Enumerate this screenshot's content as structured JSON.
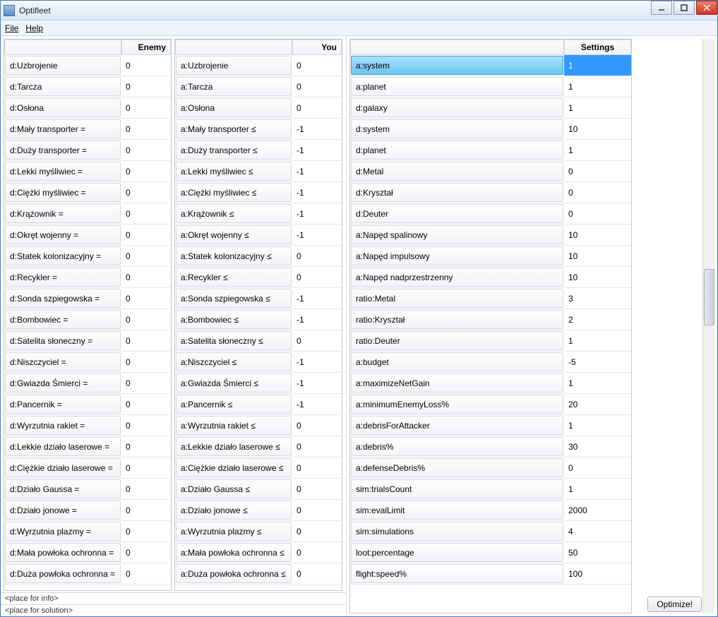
{
  "window": {
    "title": "Optifleet"
  },
  "menu": {
    "file": "File",
    "help": "Help"
  },
  "headers": {
    "enemy": "Enemy",
    "you": "You",
    "settings": "Settings"
  },
  "enemy_rows": [
    {
      "k": "d:Uzbrojenie",
      "v": "0"
    },
    {
      "k": "d:Tarcza",
      "v": "0"
    },
    {
      "k": "d:Osłona",
      "v": "0"
    },
    {
      "k": "d:Mały transporter =",
      "v": "0"
    },
    {
      "k": "d:Duży transporter =",
      "v": "0"
    },
    {
      "k": "d:Lekki myśliwiec =",
      "v": "0"
    },
    {
      "k": "d:Ciężki myśliwiec =",
      "v": "0"
    },
    {
      "k": "d:Krążownik =",
      "v": "0"
    },
    {
      "k": "d:Okręt wojenny =",
      "v": "0"
    },
    {
      "k": "d:Statek kolonizacyjny =",
      "v": "0"
    },
    {
      "k": "d:Recykler =",
      "v": "0"
    },
    {
      "k": "d:Sonda szpiegowska =",
      "v": "0"
    },
    {
      "k": "d:Bombowiec =",
      "v": "0"
    },
    {
      "k": "d:Satelita słoneczny =",
      "v": "0"
    },
    {
      "k": "d:Niszczyciel =",
      "v": "0"
    },
    {
      "k": "d:Gwiazda Śmierci =",
      "v": "0"
    },
    {
      "k": "d:Pancernik =",
      "v": "0"
    },
    {
      "k": "d:Wyrzutnia rakiet =",
      "v": "0"
    },
    {
      "k": "d:Lekkie działo laserowe =",
      "v": "0"
    },
    {
      "k": "d:Ciężkie działo laserowe =",
      "v": "0"
    },
    {
      "k": "d:Działo Gaussa =",
      "v": "0"
    },
    {
      "k": "d:Działo jonowe =",
      "v": "0"
    },
    {
      "k": "d:Wyrzutnia plazmy =",
      "v": "0"
    },
    {
      "k": "d:Mała powłoka ochronna =",
      "v": "0"
    },
    {
      "k": "d:Duża powłoka ochronna =",
      "v": "0"
    }
  ],
  "you_rows": [
    {
      "k": "a:Uzbrojenie",
      "v": "0"
    },
    {
      "k": "a:Tarcza",
      "v": "0"
    },
    {
      "k": "a:Osłona",
      "v": "0"
    },
    {
      "k": "a:Mały transporter ≤",
      "v": "-1"
    },
    {
      "k": "a:Duży transporter ≤",
      "v": "-1"
    },
    {
      "k": "a:Lekki myśliwiec ≤",
      "v": "-1"
    },
    {
      "k": "a:Ciężki myśliwiec ≤",
      "v": "-1"
    },
    {
      "k": "a:Krążownik ≤",
      "v": "-1"
    },
    {
      "k": "a:Okręt wojenny ≤",
      "v": "-1"
    },
    {
      "k": "a:Statek kolonizacyjny ≤",
      "v": "0"
    },
    {
      "k": "a:Recykler ≤",
      "v": "0"
    },
    {
      "k": "a:Sonda szpiegowska ≤",
      "v": "-1"
    },
    {
      "k": "a:Bombowiec ≤",
      "v": "-1"
    },
    {
      "k": "a:Satelita słoneczny ≤",
      "v": "0"
    },
    {
      "k": "a:Niszczyciel ≤",
      "v": "-1"
    },
    {
      "k": "a:Gwiazda Śmierci ≤",
      "v": "-1"
    },
    {
      "k": "a:Pancernik ≤",
      "v": "-1"
    },
    {
      "k": "a:Wyrzutnia rakiet ≤",
      "v": "0"
    },
    {
      "k": "a:Lekkie działo laserowe ≤",
      "v": "0"
    },
    {
      "k": "a:Ciężkie działo laserowe ≤",
      "v": "0"
    },
    {
      "k": "a:Działo Gaussa ≤",
      "v": "0"
    },
    {
      "k": "a:Działo jonowe ≤",
      "v": "0"
    },
    {
      "k": "a:Wyrzutnia plazmy ≤",
      "v": "0"
    },
    {
      "k": "a:Mała powłoka ochronna ≤",
      "v": "0"
    },
    {
      "k": "a:Duża powłoka ochronna ≤",
      "v": "0"
    }
  ],
  "settings_rows": [
    {
      "k": "a:system",
      "v": "1",
      "selected": true
    },
    {
      "k": "a:planet",
      "v": "1"
    },
    {
      "k": "d:galaxy",
      "v": "1"
    },
    {
      "k": "d:system",
      "v": "10"
    },
    {
      "k": "d:planet",
      "v": "1"
    },
    {
      "k": "d:Metal",
      "v": "0"
    },
    {
      "k": "d:Kryształ",
      "v": "0"
    },
    {
      "k": "d:Deuter",
      "v": "0"
    },
    {
      "k": "a:Napęd spalinowy",
      "v": "10"
    },
    {
      "k": "a:Napęd impulsowy",
      "v": "10"
    },
    {
      "k": "a:Napęd nadprzestrzenny",
      "v": "10"
    },
    {
      "k": "ratio:Metal",
      "v": "3"
    },
    {
      "k": "ratio:Kryształ",
      "v": "2"
    },
    {
      "k": "ratio:Deuter",
      "v": "1"
    },
    {
      "k": "a:budget",
      "v": "-5"
    },
    {
      "k": "a:maximizeNetGain",
      "v": "1"
    },
    {
      "k": "a:minimumEnemyLoss%",
      "v": "20"
    },
    {
      "k": "a:debrisForAttacker",
      "v": "1"
    },
    {
      "k": "a:debris%",
      "v": "30"
    },
    {
      "k": "a:defenseDebris%",
      "v": "0"
    },
    {
      "k": "sim:trialsCount",
      "v": "1"
    },
    {
      "k": "sim:evalLimit",
      "v": "2000"
    },
    {
      "k": "sim:simulations",
      "v": "4"
    },
    {
      "k": "loot:percentage",
      "v": "50"
    },
    {
      "k": "flight:speed%",
      "v": "100"
    }
  ],
  "footer": {
    "info": "<place for info>",
    "solution": "<place for solution>"
  },
  "buttons": {
    "optimize": "Optimize!"
  }
}
